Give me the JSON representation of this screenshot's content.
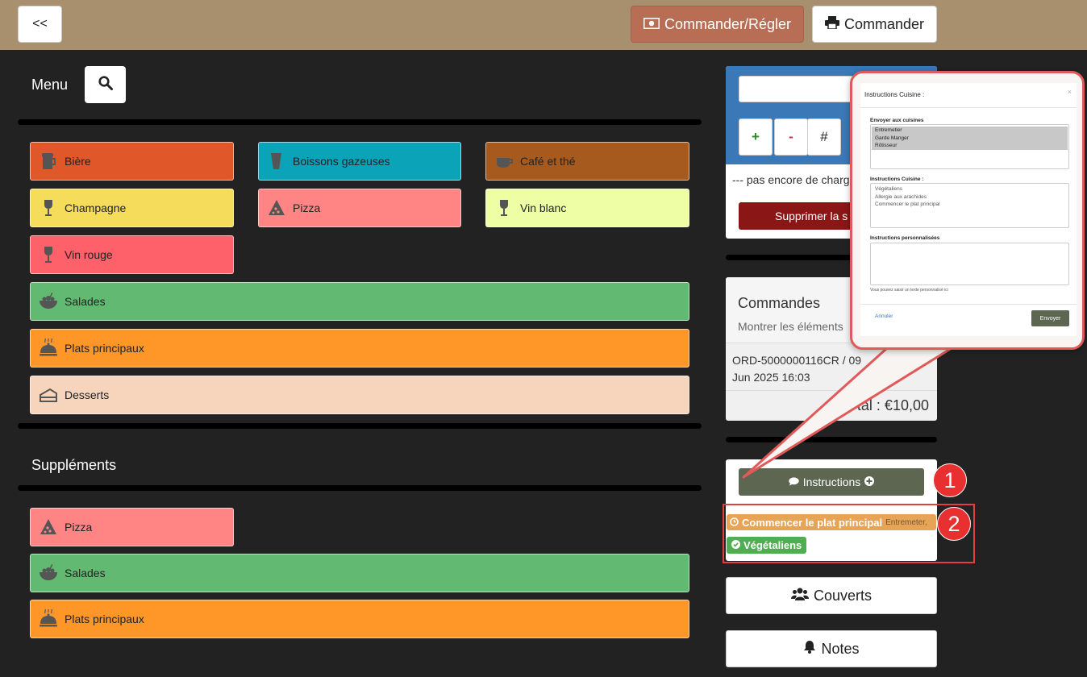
{
  "topbar": {
    "back_label": "<<",
    "pay_label": "Commander/Régler",
    "order_label": "Commander"
  },
  "menu": {
    "title": "Menu",
    "categories": [
      {
        "label": "Bière",
        "icon": "beer-icon",
        "color": "#e0572a"
      },
      {
        "label": "Boissons gazeuses",
        "icon": "soda-icon",
        "color": "#0aa3b8"
      },
      {
        "label": "Café et thé",
        "icon": "coffee-icon",
        "color": "#a65a1e"
      },
      {
        "label": "Champagne",
        "icon": "wine-glass-icon",
        "color": "#f5dc5a"
      },
      {
        "label": "Pizza",
        "icon": "pizza-icon",
        "color": "#ff8585"
      },
      {
        "label": "Vin blanc",
        "icon": "wine-glass-icon",
        "color": "#eefea5"
      },
      {
        "label": "Vin rouge",
        "icon": "wine-glass-icon",
        "color": "#ff616a"
      },
      {
        "label": "Salades",
        "icon": "salad-bowl-icon",
        "color": "#62b971"
      },
      {
        "label": "Plats principaux",
        "icon": "cloche-icon",
        "color": "#ff9628"
      },
      {
        "label": "Desserts",
        "icon": "cake-icon",
        "color": "#f7d4bc"
      }
    ]
  },
  "supplements": {
    "title": "Suppléments",
    "categories": [
      {
        "label": "Pizza",
        "icon": "pizza-icon",
        "color": "#ff8585"
      },
      {
        "label": "Salades",
        "icon": "salad-bowl-icon",
        "color": "#62b971"
      },
      {
        "label": "Plats principaux",
        "icon": "cloche-icon",
        "color": "#ff9628"
      }
    ]
  },
  "numpad": {
    "plus": "+",
    "minus": "-",
    "hash": "#",
    "status": "--- pas encore de charg",
    "delete_label": "Supprimer la s"
  },
  "orders": {
    "title": "Commandes",
    "show_items": "Montrer les éléments",
    "ref": "ORD-5000000116CR / 09 Jun 2025 16:03",
    "total": "tal : €10,00"
  },
  "instructions": {
    "button_label": "Instructions",
    "main_badge": "Commencer le plat principal",
    "main_badge_small": "Entremeter,",
    "veg_badge": "Végétaliens"
  },
  "annotations": {
    "step1": "1",
    "step2": "2"
  },
  "covers_label": "Couverts",
  "notes_label": "Notes",
  "modal": {
    "title": "Instructions Cuisine :",
    "close": "×",
    "send_to_kitchens_label": "Envoyer aux cuisines",
    "kitchens": [
      "Entremetier",
      "Garde Manger",
      "Rôtisseur"
    ],
    "instructions_label": "Instructions Cuisine :",
    "instructions": [
      "Végétaliens",
      "Allergie aux arachides",
      "Commencer le plat principal"
    ],
    "custom_label": "Instructions personnalisées",
    "custom_hint": "Vous pouvez saisir un texte personnalisé ici",
    "cancel": "Annuler",
    "send": "Envoyer"
  }
}
